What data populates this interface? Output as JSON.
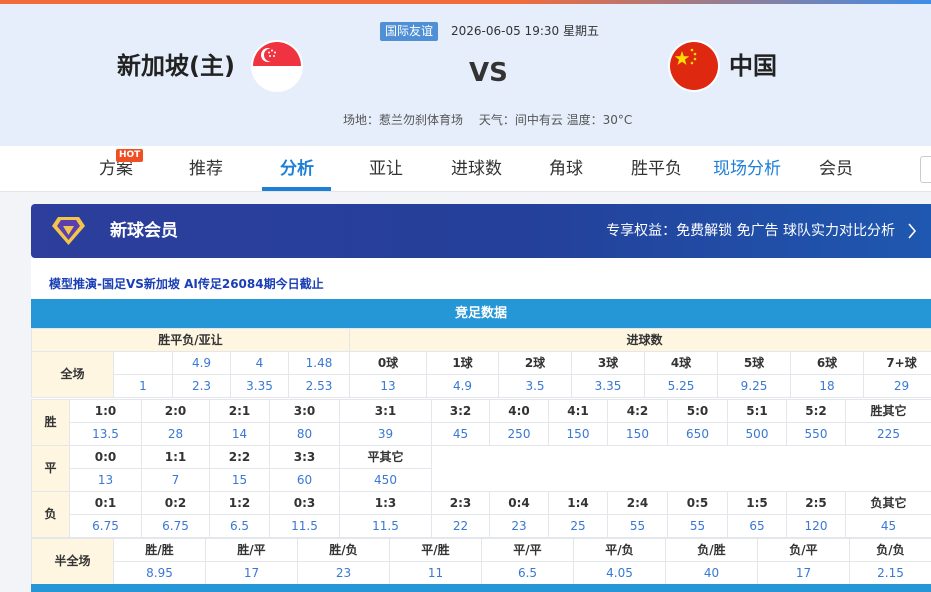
{
  "match": {
    "league": "国际友谊",
    "datetime": "2026-06-05 19:30 星期五",
    "home_name": "新加坡(主)",
    "away_name": "中国",
    "vs": "VS",
    "venue": "场地：惹兰勿刹体育场",
    "weather": "天气：间中有云 温度：30°C"
  },
  "nav": {
    "hot_badge": "HOT",
    "items": [
      "方案",
      "推荐",
      "分析",
      "亚让",
      "进球数",
      "角球",
      "胜平负",
      "现场分析",
      "会员"
    ],
    "active": "分析"
  },
  "member": {
    "title": "新球会员",
    "rights": "专享权益：免费解锁 免广告 球队实力对比分析"
  },
  "promo_link": "模型推演-国足VS新加坡 AI传足26084期今日截止",
  "section_title": "竞足数据",
  "odds_table": {
    "left_header": "胜平负/亚让",
    "right_header": "进球数",
    "full_time_label": "全场",
    "row1": [
      "",
      "4.9",
      "4",
      "1.48"
    ],
    "row2": [
      "1",
      "2.3",
      "3.35",
      "2.53"
    ],
    "goal_labels": [
      "0球",
      "1球",
      "2球",
      "3球",
      "4球",
      "5球",
      "6球",
      "7+球"
    ],
    "goal_values": [
      "13",
      "4.9",
      "3.5",
      "3.35",
      "5.25",
      "9.25",
      "18",
      "29"
    ]
  },
  "score_table": {
    "win_label": "胜",
    "draw_label": "平",
    "loss_label": "负",
    "win_scores": [
      "1:0",
      "2:0",
      "2:1",
      "3:0",
      "3:1",
      "3:2",
      "4:0",
      "4:1",
      "4:2",
      "5:0",
      "5:1",
      "5:2",
      "胜其它"
    ],
    "win_odds": [
      "13.5",
      "28",
      "14",
      "80",
      "39",
      "45",
      "250",
      "150",
      "150",
      "650",
      "500",
      "550",
      "225"
    ],
    "draw_scores": [
      "0:0",
      "1:1",
      "2:2",
      "3:3",
      "平其它"
    ],
    "draw_odds": [
      "13",
      "7",
      "15",
      "60",
      "450"
    ],
    "loss_scores": [
      "0:1",
      "0:2",
      "1:2",
      "0:3",
      "1:3",
      "2:3",
      "0:4",
      "1:4",
      "2:4",
      "0:5",
      "1:5",
      "2:5",
      "负其它"
    ],
    "loss_odds": [
      "6.75",
      "6.75",
      "6.5",
      "11.5",
      "11.5",
      "22",
      "23",
      "25",
      "55",
      "55",
      "65",
      "120",
      "45"
    ]
  },
  "halffull_table": {
    "label": "半全场",
    "headers": [
      "胜/胜",
      "胜/平",
      "胜/负",
      "平/胜",
      "平/平",
      "平/负",
      "负/胜",
      "负/平",
      "负/负"
    ],
    "values": [
      "8.95",
      "17",
      "23",
      "11",
      "6.5",
      "4.05",
      "40",
      "17",
      "2.15"
    ]
  },
  "colors": {
    "accent": "#1e7fd6",
    "section_bar": "#2596d6",
    "odds_text": "#3a78d4",
    "header_bg": "#fff6e2",
    "hot": "#f04e23",
    "member_banner": "#2d3e9c"
  }
}
